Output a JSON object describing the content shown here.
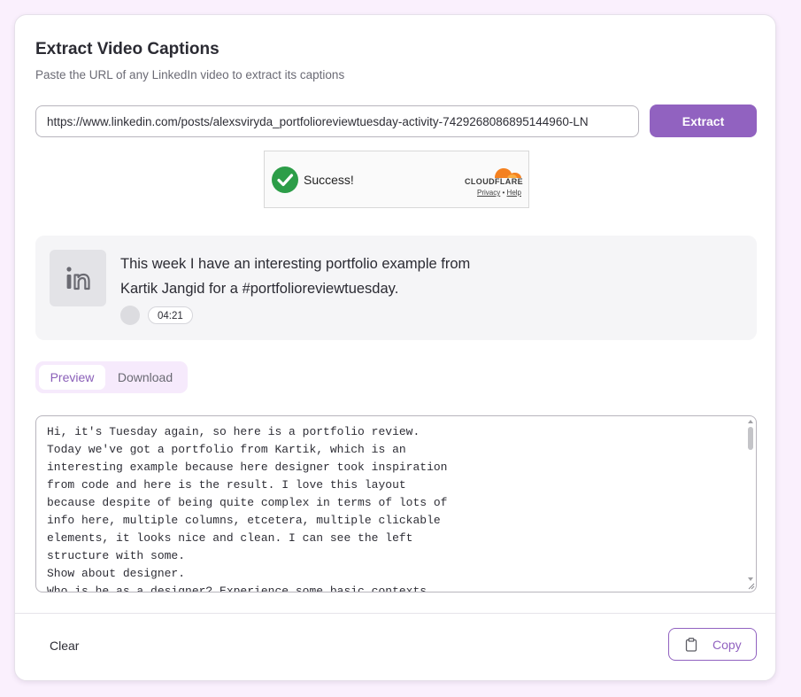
{
  "header": {
    "title": "Extract Video Captions",
    "subtitle": "Paste the URL of any LinkedIn video to extract its captions"
  },
  "url_input": {
    "value": "https://www.linkedin.com/posts/alexsviryda_portfolioreviewtuesday-activity-7429268086895144960-LN"
  },
  "extract_button": {
    "label": "Extract"
  },
  "captcha": {
    "status": "Success!",
    "brand": "CLOUDFLARE",
    "privacy_link": "Privacy",
    "separator": "•",
    "help_link": "Help"
  },
  "video": {
    "platform_icon": "linkedin-icon",
    "title": "This week I have an interesting portfolio example from Kartik Jangid for a #portfolioreviewtuesday.",
    "duration": "04:21"
  },
  "tabs": [
    {
      "label": "Preview",
      "active": true
    },
    {
      "label": "Download",
      "active": false
    }
  ],
  "captions": {
    "text": "Hi, it's Tuesday again, so here is a portfolio review.\nToday we've got a portfolio from Kartik, which is an\ninteresting example because here designer took inspiration\nfrom code and here is the result. I love this layout\nbecause despite of being quite complex in terms of lots of\ninfo here, multiple columns, etcetera, multiple clickable\nelements, it looks nice and clean. I can see the left\nstructure with some.\nShow about designer.\nWho is he as a designer? Experience some basic contexts."
  },
  "footer": {
    "clear_label": "Clear",
    "copy_label": "Copy",
    "copy_icon": "clipboard-icon"
  },
  "colors": {
    "accent": "#9162c0",
    "background": "#faf0fd",
    "success": "#2c9d48",
    "cloudflare_orange": "#f48120"
  }
}
